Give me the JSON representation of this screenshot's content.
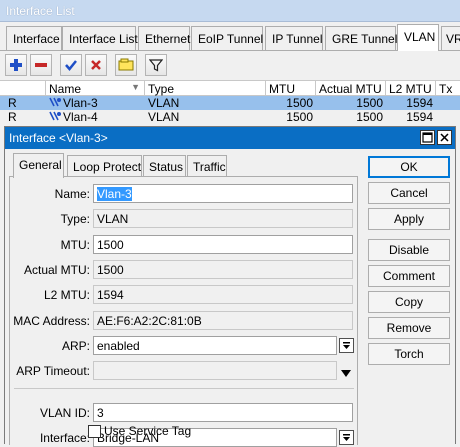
{
  "window": {
    "title": "Interface List"
  },
  "tabs": [
    {
      "label": "Interface"
    },
    {
      "label": "Interface List"
    },
    {
      "label": "Ethernet"
    },
    {
      "label": "EoIP Tunnel"
    },
    {
      "label": "IP Tunnel"
    },
    {
      "label": "GRE Tunnel"
    },
    {
      "label": "VLAN"
    },
    {
      "label": "VR"
    }
  ],
  "toolbar": {
    "icons": [
      "add-icon",
      "remove-icon",
      "enable-icon",
      "disable-icon",
      "comment-icon",
      "filter-icon"
    ]
  },
  "table": {
    "columns": [
      "",
      "Name",
      "Type",
      "MTU",
      "Actual MTU",
      "L2 MTU",
      "Tx"
    ],
    "rows": [
      {
        "flag": "R",
        "name": "Vlan-3",
        "type": "VLAN",
        "mtu": "1500",
        "actual_mtu": "1500",
        "l2_mtu": "1594",
        "selected": true
      },
      {
        "flag": "R",
        "name": "Vlan-4",
        "type": "VLAN",
        "mtu": "1500",
        "actual_mtu": "1500",
        "l2_mtu": "1594",
        "selected": false
      }
    ]
  },
  "dialog": {
    "title": "Interface <Vlan-3>",
    "tabs": [
      "General",
      "Loop Protect",
      "Status",
      "Traffic"
    ],
    "fields": {
      "name": {
        "label": "Name:",
        "value": "Vlan-3"
      },
      "type": {
        "label": "Type:",
        "value": "VLAN"
      },
      "mtu": {
        "label": "MTU:",
        "value": "1500"
      },
      "actual_mtu": {
        "label": "Actual MTU:",
        "value": "1500"
      },
      "l2_mtu": {
        "label": "L2 MTU:",
        "value": "1594"
      },
      "mac": {
        "label": "MAC Address:",
        "value": "AE:F6:A2:2C:81:0B"
      },
      "arp": {
        "label": "ARP:",
        "value": "enabled"
      },
      "arp_timeout": {
        "label": "ARP Timeout:",
        "value": ""
      },
      "vlan_id": {
        "label": "VLAN ID:",
        "value": "3"
      },
      "interface": {
        "label": "Interface:",
        "value": "Bridge-LAN"
      },
      "service_tag": {
        "label": "Use Service Tag",
        "checked": false
      }
    },
    "buttons": {
      "ok": "OK",
      "cancel": "Cancel",
      "apply": "Apply",
      "disable": "Disable",
      "comment": "Comment",
      "copy": "Copy",
      "remove": "Remove",
      "torch": "Torch"
    }
  },
  "colors": {
    "accent": "#0a6ec4",
    "selection": "#97c0ec",
    "add_icon": "#1f4fc6",
    "remove_icon": "#c62828"
  }
}
